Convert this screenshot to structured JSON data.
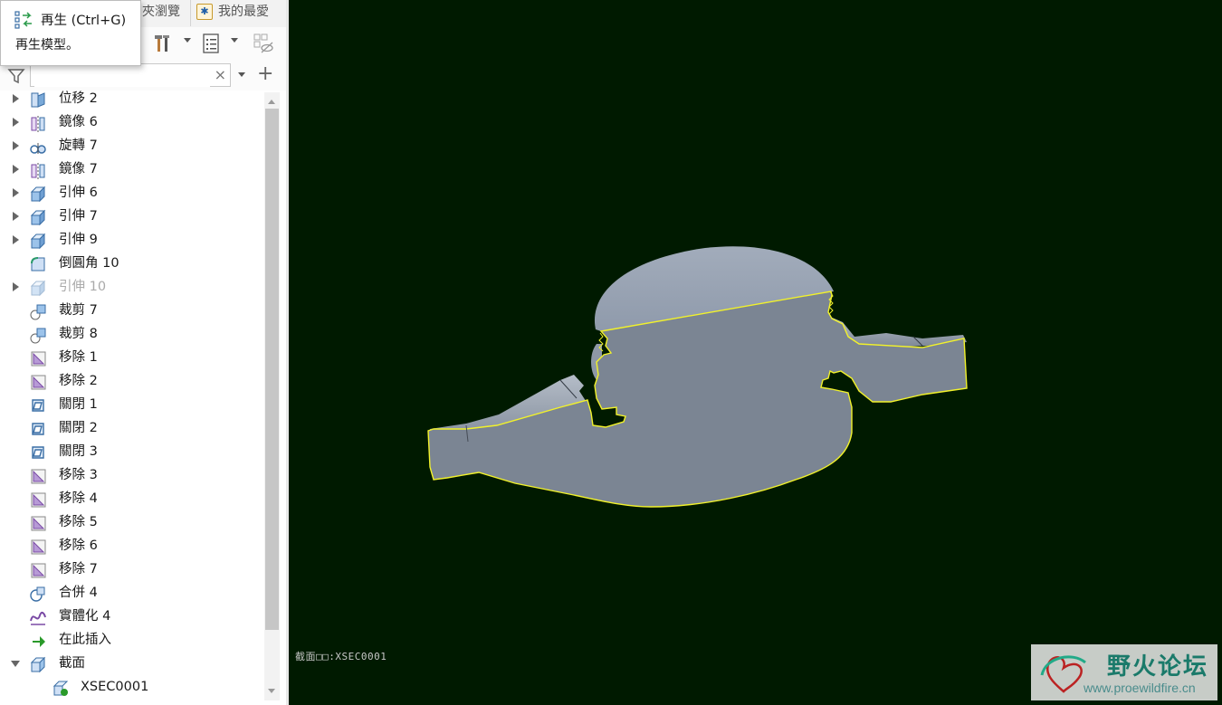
{
  "tooltip": {
    "title": "再生 (Ctrl+G)",
    "description": "再生模型。"
  },
  "tabs": {
    "folder_partial": "夾瀏覽",
    "favorites": "我的最愛"
  },
  "search": {
    "value": "",
    "placeholder": "",
    "clear_symbol": "×"
  },
  "add_symbol": "+",
  "tree": {
    "items": [
      {
        "label": "位移 2",
        "icon": "offset-icon"
      },
      {
        "label": "鏡像 6",
        "icon": "mirror-icon"
      },
      {
        "label": "旋轉 7",
        "icon": "revolve-icon"
      },
      {
        "label": "鏡像 7",
        "icon": "mirror-icon"
      },
      {
        "label": "引伸 6",
        "icon": "extrude-icon"
      },
      {
        "label": "引伸 7",
        "icon": "extrude-icon"
      },
      {
        "label": "引伸 9",
        "icon": "extrude-icon"
      },
      {
        "label": "倒圓角 10",
        "icon": "round-icon"
      },
      {
        "label": "引伸 10",
        "icon": "extrude-icon",
        "suppressed": true
      },
      {
        "label": "裁剪 7",
        "icon": "trim-icon"
      },
      {
        "label": "裁剪 8",
        "icon": "trim-icon"
      },
      {
        "label": "移除 1",
        "icon": "remove-icon"
      },
      {
        "label": "移除 2",
        "icon": "remove-icon"
      },
      {
        "label": "關閉 1",
        "icon": "close-surface-icon"
      },
      {
        "label": "關閉 2",
        "icon": "close-surface-icon"
      },
      {
        "label": "關閉 3",
        "icon": "close-surface-icon"
      },
      {
        "label": "移除 3",
        "icon": "remove-icon"
      },
      {
        "label": "移除 4",
        "icon": "remove-icon"
      },
      {
        "label": "移除 5",
        "icon": "remove-icon"
      },
      {
        "label": "移除 6",
        "icon": "remove-icon"
      },
      {
        "label": "移除 7",
        "icon": "remove-icon"
      },
      {
        "label": "合併 4",
        "icon": "merge-icon"
      },
      {
        "label": "實體化 4",
        "icon": "solidify-icon"
      },
      {
        "label": "在此插入",
        "icon": "insert-here-icon"
      },
      {
        "label": "截面",
        "icon": "section-icon"
      },
      {
        "label": "XSEC0001",
        "icon": "xsec-icon"
      }
    ]
  },
  "viewport": {
    "section_label": "截面□□:XSEC0001",
    "background": "#001a00",
    "model_color": "#7b8593",
    "edge_color": "#f2f22a"
  },
  "watermark": {
    "title": "野火论坛",
    "url": "www.proewildfire.cn"
  }
}
